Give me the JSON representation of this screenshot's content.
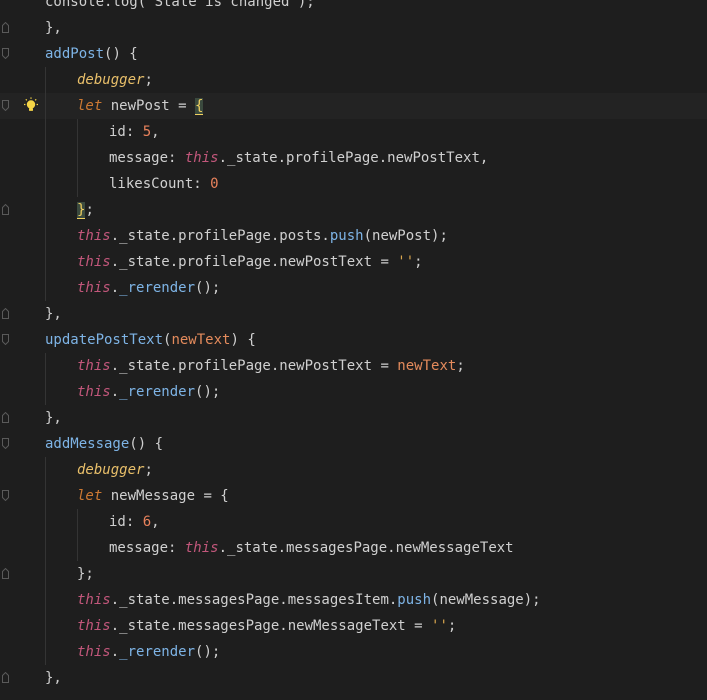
{
  "editor": {
    "lines": [
      {
        "tokens": [
          {
            "t": "console.log('State is changed');",
            "c": "prop"
          }
        ]
      },
      {
        "tokens": [
          {
            "t": "},",
            "c": "punc"
          }
        ]
      },
      {
        "tokens": [
          {
            "t": "addPost",
            "c": "fn"
          },
          {
            "t": "() {",
            "c": "punc"
          }
        ]
      },
      {
        "tokens": [
          {
            "t": "debugger",
            "c": "debug"
          },
          {
            "t": ";",
            "c": "punc"
          }
        ]
      },
      {
        "tokens": [
          {
            "t": "let",
            "c": "kw"
          },
          {
            "t": " newPost = ",
            "c": "prop"
          },
          {
            "t": "{",
            "c": "cursor-brace"
          }
        ]
      },
      {
        "tokens": [
          {
            "t": "id",
            "c": "prop"
          },
          {
            "t": ": ",
            "c": "punc"
          },
          {
            "t": "5",
            "c": "num"
          },
          {
            "t": ",",
            "c": "punc"
          }
        ]
      },
      {
        "tokens": [
          {
            "t": "message",
            "c": "prop"
          },
          {
            "t": ": ",
            "c": "punc"
          },
          {
            "t": "this",
            "c": "this"
          },
          {
            "t": "._state.profilePage.newPostText,",
            "c": "prop"
          }
        ]
      },
      {
        "tokens": [
          {
            "t": "likesCount",
            "c": "prop"
          },
          {
            "t": ": ",
            "c": "punc"
          },
          {
            "t": "0",
            "c": "num"
          }
        ]
      },
      {
        "tokens": [
          {
            "t": "}",
            "c": "cursor-brace"
          },
          {
            "t": ";",
            "c": "punc"
          }
        ]
      },
      {
        "tokens": [
          {
            "t": "this",
            "c": "this"
          },
          {
            "t": "._state.profilePage.posts.",
            "c": "prop"
          },
          {
            "t": "push",
            "c": "fn"
          },
          {
            "t": "(newPost);",
            "c": "prop"
          }
        ]
      },
      {
        "tokens": [
          {
            "t": "this",
            "c": "this"
          },
          {
            "t": "._state.profilePage.newPostText = ",
            "c": "prop"
          },
          {
            "t": "''",
            "c": "str"
          },
          {
            "t": ";",
            "c": "punc"
          }
        ]
      },
      {
        "tokens": [
          {
            "t": "this",
            "c": "this"
          },
          {
            "t": ".",
            "c": "prop"
          },
          {
            "t": "_rerender",
            "c": "fn"
          },
          {
            "t": "();",
            "c": "punc"
          }
        ]
      },
      {
        "tokens": [
          {
            "t": "},",
            "c": "punc"
          }
        ]
      },
      {
        "tokens": [
          {
            "t": "updatePostText",
            "c": "fn"
          },
          {
            "t": "(",
            "c": "punc"
          },
          {
            "t": "newText",
            "c": "param"
          },
          {
            "t": ") {",
            "c": "punc"
          }
        ]
      },
      {
        "tokens": [
          {
            "t": "this",
            "c": "this"
          },
          {
            "t": "._state.profilePage.newPostText = ",
            "c": "prop"
          },
          {
            "t": "newText",
            "c": "param"
          },
          {
            "t": ";",
            "c": "punc"
          }
        ]
      },
      {
        "tokens": [
          {
            "t": "this",
            "c": "this"
          },
          {
            "t": ".",
            "c": "prop"
          },
          {
            "t": "_rerender",
            "c": "fn"
          },
          {
            "t": "();",
            "c": "punc"
          }
        ]
      },
      {
        "tokens": [
          {
            "t": "},",
            "c": "punc"
          }
        ]
      },
      {
        "tokens": [
          {
            "t": "addMessage",
            "c": "fn"
          },
          {
            "t": "() {",
            "c": "punc"
          }
        ]
      },
      {
        "tokens": [
          {
            "t": "debugger",
            "c": "debug"
          },
          {
            "t": ";",
            "c": "punc"
          }
        ]
      },
      {
        "tokens": [
          {
            "t": "let",
            "c": "kw"
          },
          {
            "t": " newMessage = {",
            "c": "prop"
          }
        ]
      },
      {
        "tokens": [
          {
            "t": "id",
            "c": "prop"
          },
          {
            "t": ": ",
            "c": "punc"
          },
          {
            "t": "6",
            "c": "num"
          },
          {
            "t": ",",
            "c": "punc"
          }
        ]
      },
      {
        "tokens": [
          {
            "t": "message",
            "c": "prop"
          },
          {
            "t": ": ",
            "c": "punc"
          },
          {
            "t": "this",
            "c": "this"
          },
          {
            "t": "._state.messagesPage.newMessageText",
            "c": "prop"
          }
        ]
      },
      {
        "tokens": [
          {
            "t": "};",
            "c": "punc"
          }
        ]
      },
      {
        "tokens": [
          {
            "t": "this",
            "c": "this"
          },
          {
            "t": "._state.messagesPage.messagesItem.",
            "c": "prop"
          },
          {
            "t": "push",
            "c": "fn"
          },
          {
            "t": "(newMessage);",
            "c": "prop"
          }
        ]
      },
      {
        "tokens": [
          {
            "t": "this",
            "c": "this"
          },
          {
            "t": "._state.messagesPage.newMessageText = ",
            "c": "prop"
          },
          {
            "t": "''",
            "c": "str"
          },
          {
            "t": ";",
            "c": "punc"
          }
        ]
      },
      {
        "tokens": [
          {
            "t": "this",
            "c": "this"
          },
          {
            "t": ".",
            "c": "prop"
          },
          {
            "t": "_rerender",
            "c": "fn"
          },
          {
            "t": "();",
            "c": "punc"
          }
        ]
      },
      {
        "tokens": [
          {
            "t": "},",
            "c": "punc"
          }
        ]
      }
    ]
  },
  "gutter": {
    "intention_icon": "lightbulb-icon",
    "fold_icon": "fold-marker-icon"
  },
  "colors": {
    "background": "#1e1e1e",
    "current_line": "#232323",
    "keyword": "#cc7832",
    "this": "#c2577b",
    "function": "#7eb4e6",
    "number": "#e9825c",
    "string": "#d9a64e",
    "bulb": "#f5d547"
  }
}
